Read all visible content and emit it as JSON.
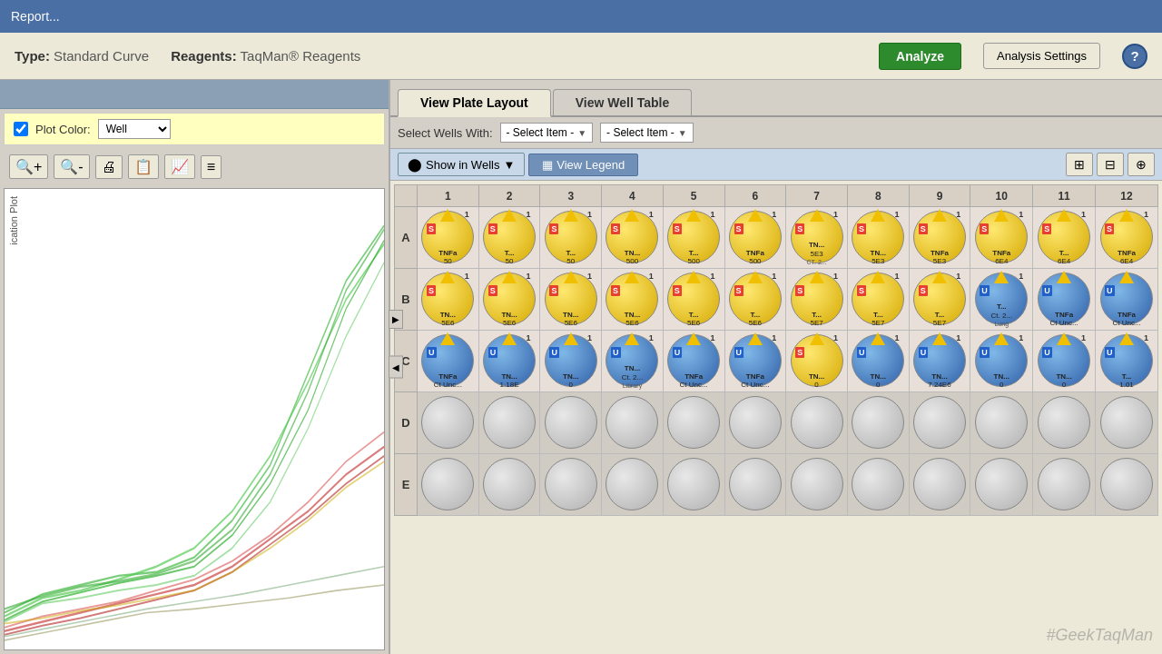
{
  "titleBar": {
    "label": "Report..."
  },
  "header": {
    "typeLabel": "Type:",
    "typeValue": "Standard Curve",
    "reagentsLabel": "Reagents:",
    "reagentsValue": "TaqMan® Reagents",
    "analyzeBtn": "Analyze",
    "analysisSettingsBtn": "Analysis Settings",
    "helpBtn": "?"
  },
  "leftPanel": {
    "plotColorLabel": "Plot Color:",
    "plotColorValue": "Well",
    "chartLabel": "ication Plot",
    "toolbarBtns": [
      "🔍+",
      "🔍-",
      "🖨",
      "📋",
      "📈",
      "≡"
    ]
  },
  "tabs": [
    {
      "label": "View Plate Layout",
      "active": true
    },
    {
      "label": "View Well Table",
      "active": false
    }
  ],
  "controls": {
    "selectWellsLabel": "Select Wells With:",
    "dropdown1": "- Select Item -",
    "dropdown2": "- Select Item -"
  },
  "actionBar": {
    "showInWellsBtn": "Show in Wells",
    "viewLegendBtn": "View Legend",
    "gridBtns": [
      "⊞",
      "⊟",
      "⊕"
    ]
  },
  "plate": {
    "columns": [
      "1",
      "2",
      "3",
      "4",
      "5",
      "6",
      "7",
      "8",
      "9",
      "10",
      "11",
      "12"
    ],
    "rows": [
      "A",
      "B",
      "C",
      "D",
      "E"
    ],
    "watermark": "#GeekTaqMan"
  }
}
